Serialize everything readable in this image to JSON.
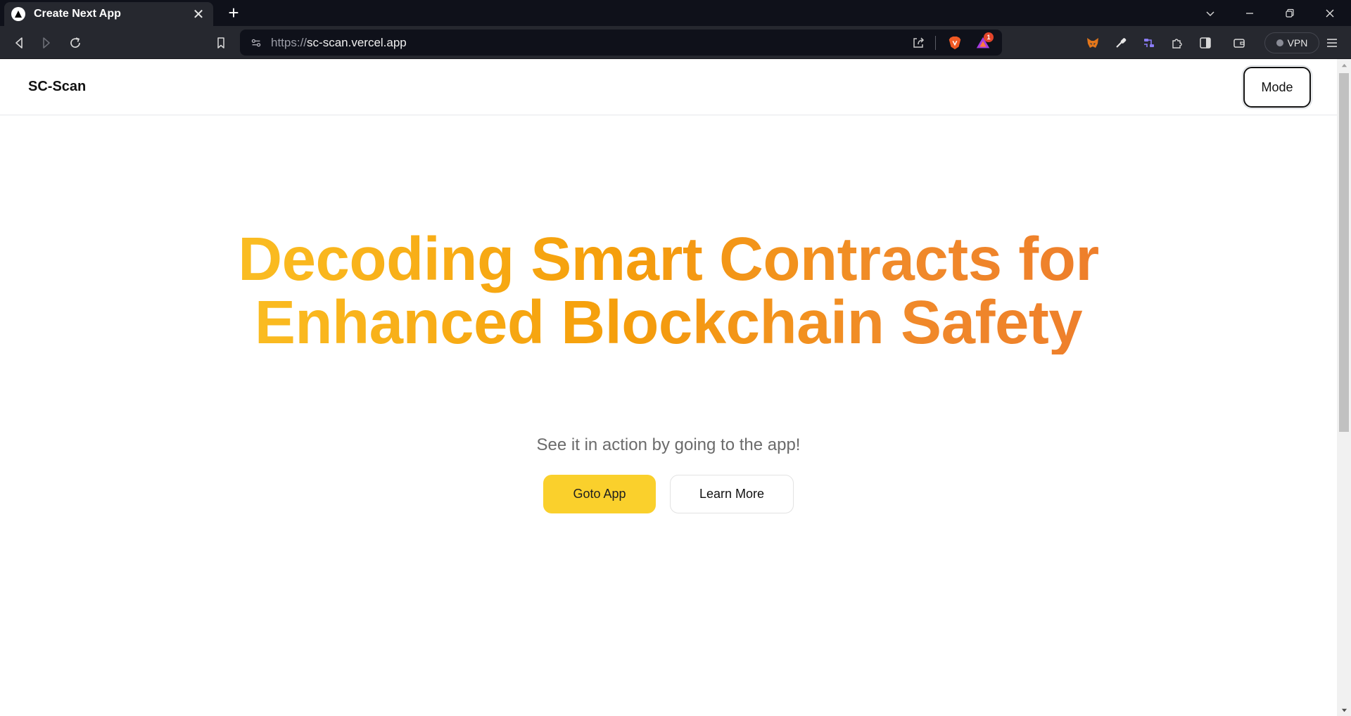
{
  "browser": {
    "tab": {
      "title": "Create Next App",
      "close": "✕"
    },
    "new_tab": "+",
    "url": {
      "scheme": "https://",
      "host": "sc-scan.vercel.app"
    },
    "rewards_badge": "1",
    "vpn_label": "VPN"
  },
  "site": {
    "logo": "SC-Scan",
    "mode_button": "Mode"
  },
  "hero": {
    "title": "Decoding Smart Contracts for Enhanced Blockchain Safety",
    "subtitle": "See it in action by going to the app!",
    "primary_button": "Goto App",
    "secondary_button": "Learn More"
  },
  "colors": {
    "primary_button": "#fad02c",
    "title_gradient_start": "#fbbf24",
    "title_gradient_end": "#ee7d2b"
  }
}
